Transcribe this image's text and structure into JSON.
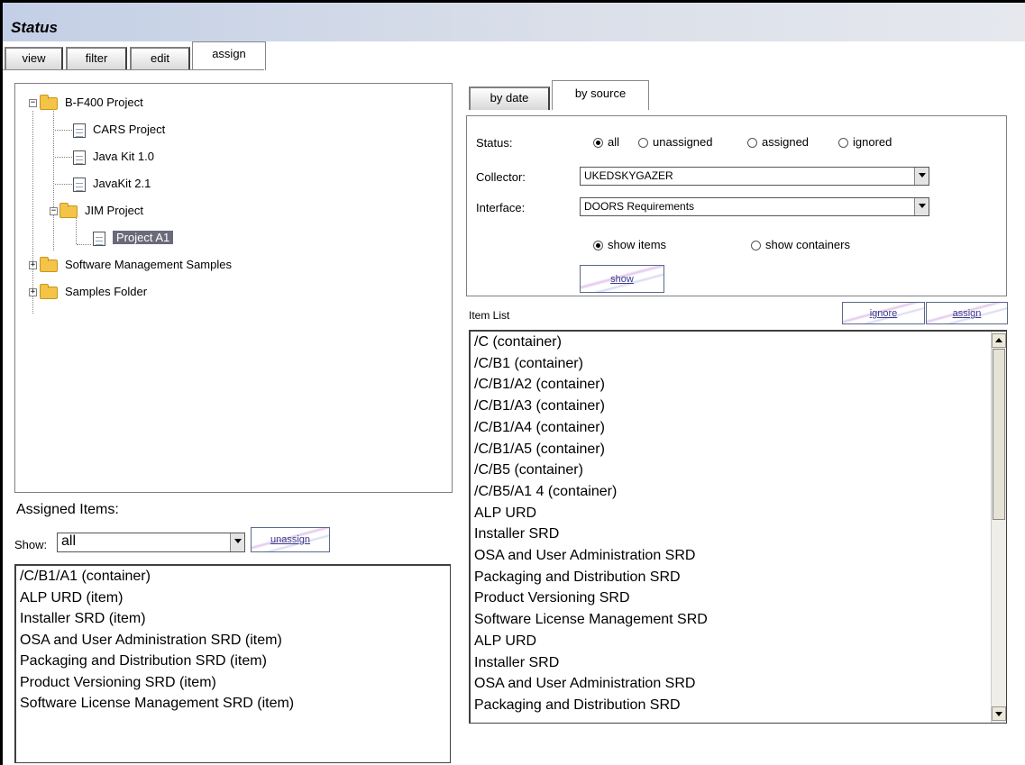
{
  "title": "Status",
  "main_tabs": [
    {
      "label": "view",
      "active": false
    },
    {
      "label": "filter",
      "active": false
    },
    {
      "label": "edit",
      "active": false
    },
    {
      "label": "assign",
      "active": true
    }
  ],
  "tree": {
    "items": [
      {
        "label": "B-F400 Project",
        "type": "folder",
        "expanded": true
      },
      {
        "label": "CARS Project",
        "type": "document"
      },
      {
        "label": "Java Kit 1.0",
        "type": "document"
      },
      {
        "label": "JavaKit 2.1",
        "type": "document"
      },
      {
        "label": "JIM Project",
        "type": "folder",
        "expanded": true
      },
      {
        "label": "Project A1",
        "type": "document",
        "selected": true
      },
      {
        "label": "Software Management Samples",
        "type": "folder",
        "expanded": false
      },
      {
        "label": "Samples Folder",
        "type": "folder",
        "expanded": false
      }
    ]
  },
  "assigned": {
    "heading": "Assigned Items:",
    "show_label": "Show:",
    "show_value": "all",
    "unassign_label": "unassign",
    "items": [
      "/C/B1/A1 (container)",
      "ALP URD (item)",
      "Installer SRD (item)",
      "OSA and User Administration SRD (item)",
      "Packaging and Distribution SRD (item)",
      "Product Versioning SRD (item)",
      "Software License Management SRD (item)"
    ]
  },
  "source_tabs": [
    {
      "label": "by date",
      "active": false
    },
    {
      "label": "by source",
      "active": true
    }
  ],
  "filters": {
    "status_label": "Status:",
    "status_options": [
      {
        "label": "all",
        "selected": true
      },
      {
        "label": "unassigned",
        "selected": false
      },
      {
        "label": "assigned",
        "selected": false
      },
      {
        "label": "ignored",
        "selected": false
      }
    ],
    "collector_label": "Collector:",
    "collector_value": "UKEDSKYGAZER",
    "interface_label": "Interface:",
    "interface_value": "DOORS Requirements",
    "view_options": [
      {
        "label": "show items",
        "selected": true
      },
      {
        "label": "show containers",
        "selected": false
      }
    ],
    "show_button": "show"
  },
  "item_list": {
    "label": "Item List",
    "ignore_button": "ignore",
    "assign_button": "assign",
    "items": [
      "/C (container)",
      "/C/B1 (container)",
      "/C/B1/A2 (container)",
      "/C/B1/A3 (container)",
      "/C/B1/A4 (container)",
      "/C/B1/A5 (container)",
      "/C/B5 (container)",
      "/C/B5/A1 4 (container)",
      "ALP URD",
      "Installer SRD",
      "OSA and User Administration SRD",
      "Packaging and Distribution SRD",
      "Product Versioning SRD",
      "Software License Management SRD",
      "ALP URD",
      "Installer SRD",
      "OSA and User Administration SRD",
      "Packaging and Distribution SRD"
    ]
  }
}
